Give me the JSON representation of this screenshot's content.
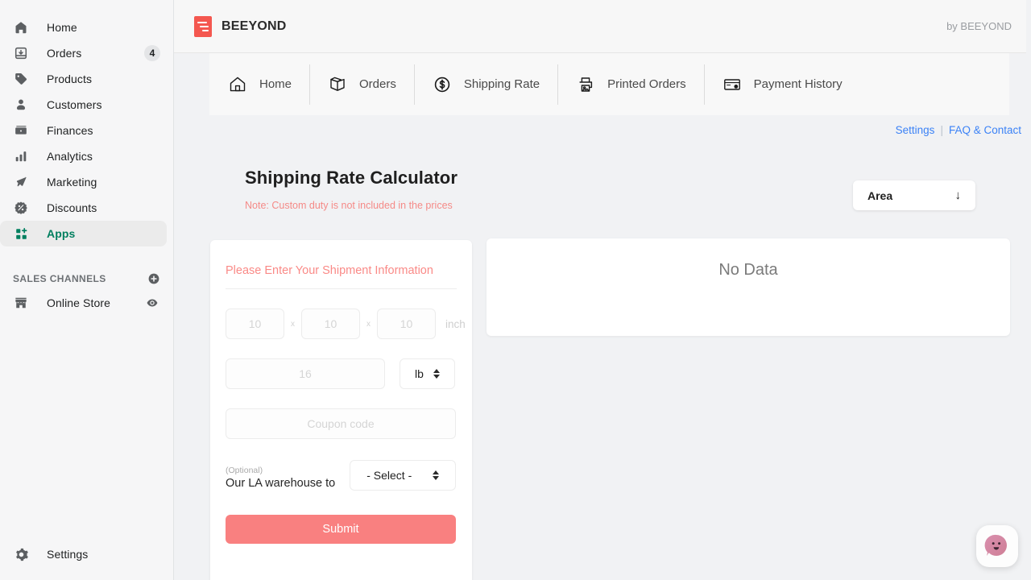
{
  "sidebar": {
    "items": [
      {
        "label": "Home",
        "icon": "home-icon",
        "badge": null,
        "active": false
      },
      {
        "label": "Orders",
        "icon": "orders-inbox-icon",
        "badge": "4",
        "active": false
      },
      {
        "label": "Products",
        "icon": "tag-icon",
        "badge": null,
        "active": false
      },
      {
        "label": "Customers",
        "icon": "person-icon",
        "badge": null,
        "active": false
      },
      {
        "label": "Finances",
        "icon": "cash-icon",
        "badge": null,
        "active": false
      },
      {
        "label": "Analytics",
        "icon": "bar-chart-icon",
        "badge": null,
        "active": false
      },
      {
        "label": "Marketing",
        "icon": "megaphone-icon",
        "badge": null,
        "active": false
      },
      {
        "label": "Discounts",
        "icon": "discount-percent-icon",
        "badge": null,
        "active": false
      },
      {
        "label": "Apps",
        "icon": "apps-grid-plus-icon",
        "badge": null,
        "active": true
      }
    ],
    "section": {
      "title": "SALES CHANNELS",
      "add_icon": "plus-circle-icon",
      "channels": [
        {
          "label": "Online Store",
          "icon": "storefront-icon",
          "trailing_icon": "eye-icon"
        }
      ]
    },
    "footer": {
      "label": "Settings",
      "icon": "gear-icon"
    },
    "active_color": "#007f5f"
  },
  "topbar": {
    "logo_icon": "beeyond-logo-icon",
    "brand": "BEEYOND",
    "byline": "by BEEYOND",
    "logo_color": "#f4574f"
  },
  "appnav": {
    "tabs": [
      {
        "label": "Home",
        "icon": "home-outline-icon"
      },
      {
        "label": "Orders",
        "icon": "box-open-icon"
      },
      {
        "label": "Shipping Rate",
        "icon": "dollar-circle-icon"
      },
      {
        "label": "Printed Orders",
        "icon": "printer-icon"
      },
      {
        "label": "Payment History",
        "icon": "credit-card-icon"
      }
    ]
  },
  "links": {
    "settings": "Settings",
    "separator": "|",
    "faq": "FAQ & Contact",
    "link_color": "#3b82f6"
  },
  "page": {
    "title": "Shipping Rate Calculator",
    "note": "Note: Custom duty is not included in the prices",
    "note_color": "#f58a87"
  },
  "area_button": {
    "label": "Area",
    "arrow_icon": "arrow-down-icon",
    "arrow_glyph": "↓"
  },
  "form": {
    "heading": "Please Enter Your Shipment Information",
    "heading_color": "#fa8a87",
    "dimensions": {
      "length_placeholder": "10",
      "width_placeholder": "10",
      "height_placeholder": "10",
      "multiply_symbol": "x",
      "unit": "inch"
    },
    "weight": {
      "placeholder": "16",
      "unit_value": "lb"
    },
    "coupon": {
      "placeholder": "Coupon code"
    },
    "warehouse": {
      "optional_label": "(Optional)",
      "label": "Our LA warehouse to",
      "select_value": "- Select -"
    },
    "submit_label": "Submit",
    "submit_color": "#f98080"
  },
  "result": {
    "empty_text": "No Data"
  },
  "chat": {
    "icon": "chat-bubble-face-icon"
  }
}
